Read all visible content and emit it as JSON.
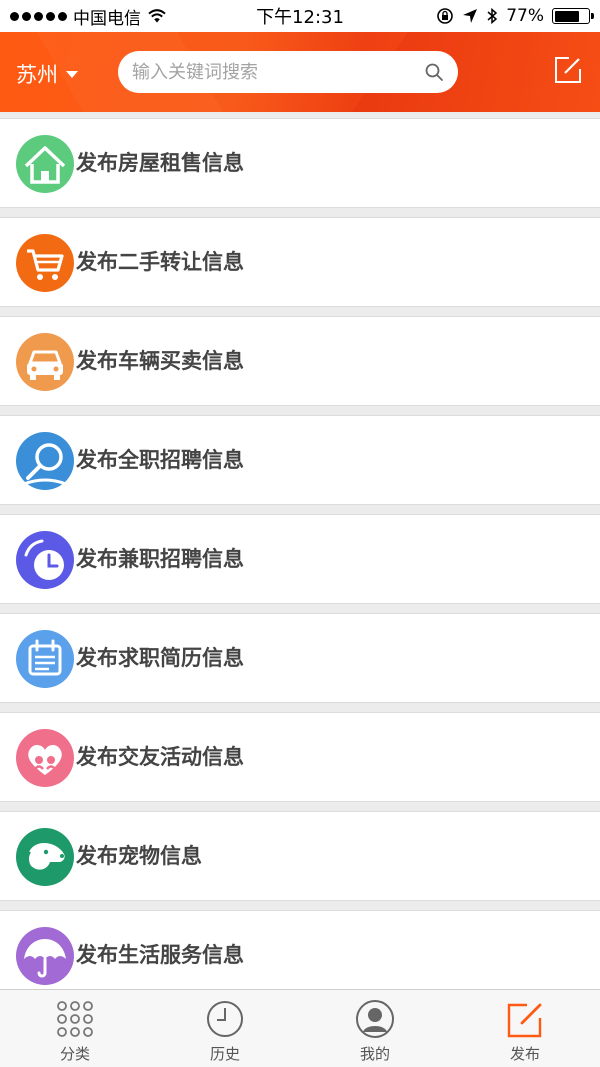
{
  "status_bar": {
    "carrier": "中国电信",
    "time": "下午12:31",
    "battery": "77%",
    "battery_level": 0.77
  },
  "header": {
    "city": "苏州",
    "search_placeholder": "输入关键词搜索",
    "icons": [
      "caret-down-icon",
      "search-icon",
      "compose-icon"
    ]
  },
  "colors": {
    "brand": "#ff5a14",
    "house": "#5ccb7e",
    "cart": "#f26a12",
    "car": "#f09a4e",
    "fulltime": "#3a8fd8",
    "parttime": "#5a5ae6",
    "resume": "#5aa0ea",
    "social": "#f0708c",
    "pet": "#1e9a6a",
    "life": "#a26ad4"
  },
  "items": [
    {
      "label": "发布房屋租售信息",
      "icon": "house-icon"
    },
    {
      "label": "发布二手转让信息",
      "icon": "cart-icon"
    },
    {
      "label": "发布车辆买卖信息",
      "icon": "car-icon"
    },
    {
      "label": "发布全职招聘信息",
      "icon": "magnifier-icon"
    },
    {
      "label": "发布兼职招聘信息",
      "icon": "clock-icon"
    },
    {
      "label": "发布求职简历信息",
      "icon": "calendar-icon"
    },
    {
      "label": "发布交友活动信息",
      "icon": "heart-icon"
    },
    {
      "label": "发布宠物信息",
      "icon": "dog-icon"
    },
    {
      "label": "发布生活服务信息",
      "icon": "umbrella-icon"
    }
  ],
  "tabs": [
    {
      "label": "分类",
      "icon": "grid-icon",
      "active": false
    },
    {
      "label": "历史",
      "icon": "clock-icon",
      "active": false
    },
    {
      "label": "我的",
      "icon": "user-icon",
      "active": false
    },
    {
      "label": "发布",
      "icon": "compose-icon",
      "active": true
    }
  ]
}
